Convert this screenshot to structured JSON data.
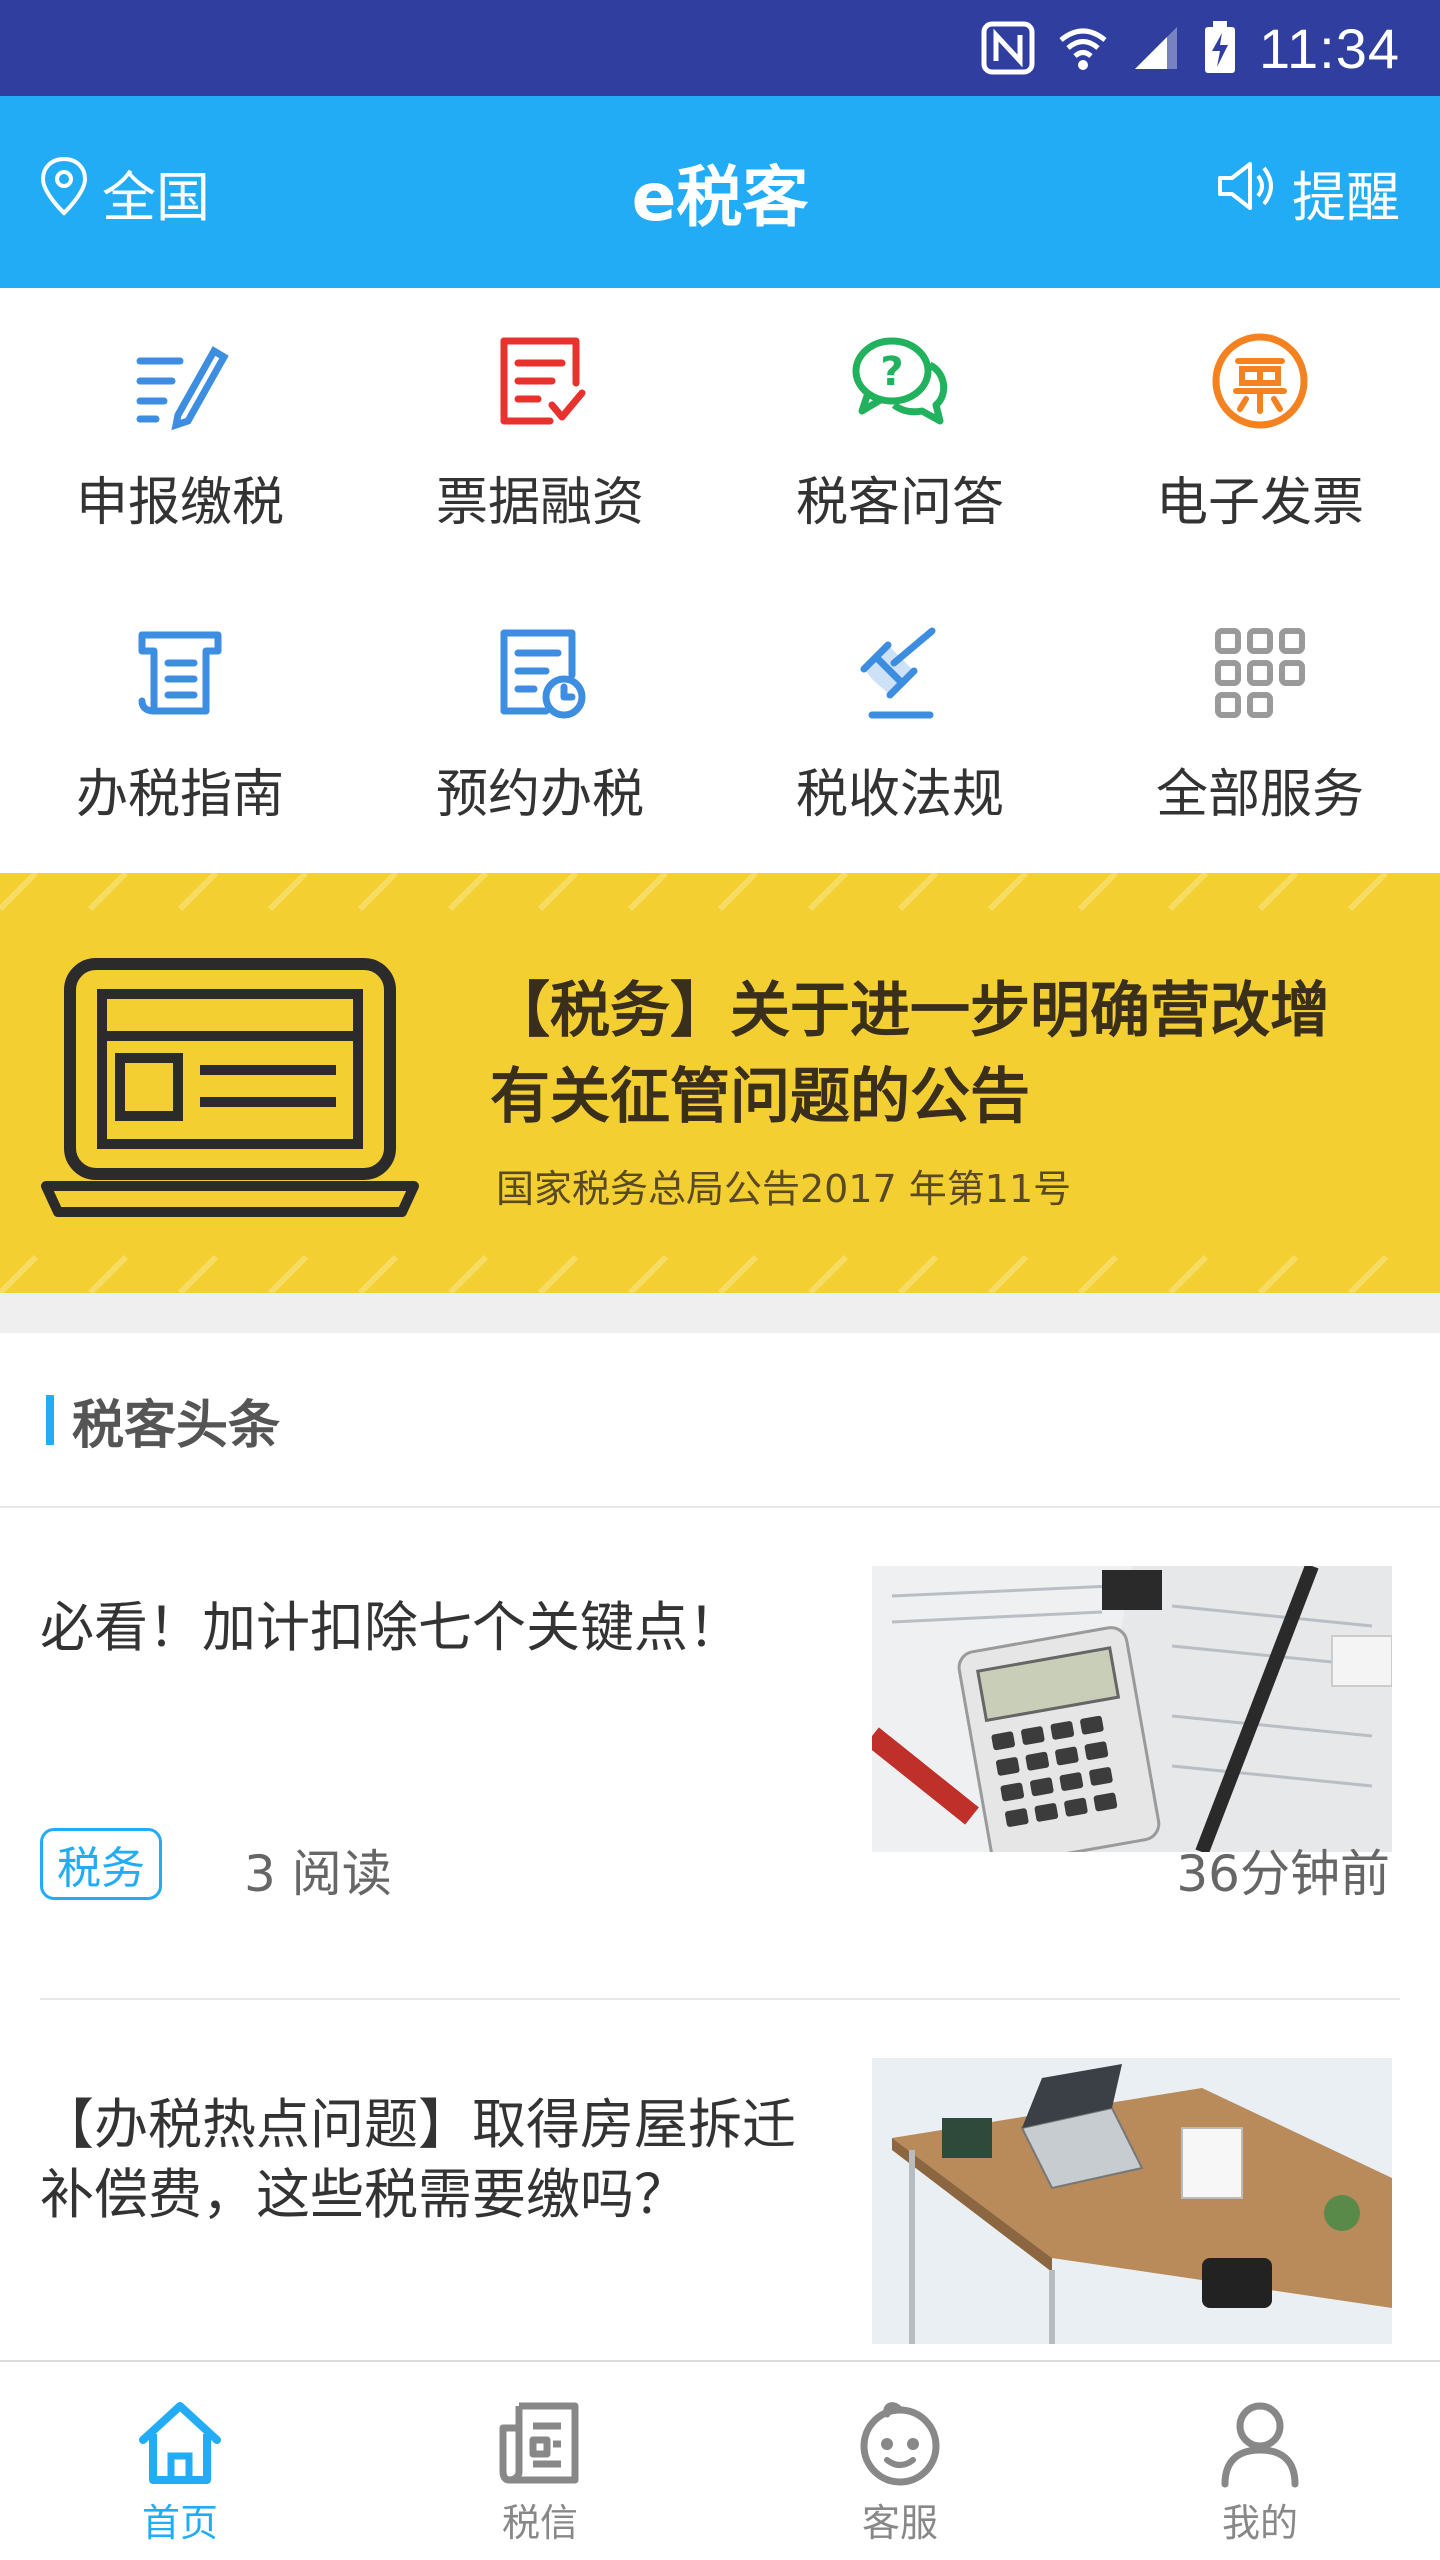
{
  "status_bar": {
    "time": "11:34",
    "icons": [
      "nfc-icon",
      "wifi-icon",
      "signal-icon",
      "battery-charging-icon"
    ]
  },
  "app_bar": {
    "location": "全国",
    "title": "e税客",
    "remind": "提醒",
    "icons": [
      "location-pin-icon",
      "speaker-icon"
    ]
  },
  "services": [
    {
      "label": "申报缴税",
      "icon": "declare-pen-icon",
      "color": "#3d8de0"
    },
    {
      "label": "票据融资",
      "icon": "invoice-finance-icon",
      "color": "#e8322e"
    },
    {
      "label": "税客问答",
      "icon": "chat-question-icon",
      "color": "#22b15d"
    },
    {
      "label": "电子发票",
      "icon": "ticket-coin-icon",
      "color": "#f58220"
    },
    {
      "label": "办税指南",
      "icon": "guide-scroll-icon",
      "color": "#3d8de0"
    },
    {
      "label": "预约办税",
      "icon": "appointment-clock-icon",
      "color": "#3d8de0"
    },
    {
      "label": "税收法规",
      "icon": "gavel-icon",
      "color": "#3d8de0"
    },
    {
      "label": "全部服务",
      "icon": "grid-icon",
      "color": "#9a9a9a"
    }
  ],
  "banner": {
    "title_line1": "【税务】关于进一步明确营改增",
    "title_line2": "有关征管问题的公告",
    "subtitle": "国家税务总局公告2017 年第11号",
    "bg_color": "#f4cf31"
  },
  "news_section": {
    "title": "税客头条",
    "items": [
      {
        "title": "必看！加计扣除七个关键点！",
        "tag": "税务",
        "reads": "3 阅读",
        "time": "36分钟前",
        "image": "calculator-tax-forms-photo"
      },
      {
        "title": "【办税热点问题】取得房屋拆迁补偿费，这些税需要缴吗？",
        "image": "office-desk-photo"
      }
    ]
  },
  "bottom_nav": {
    "tabs": [
      {
        "label": "首页",
        "icon": "home-icon",
        "active": true
      },
      {
        "label": "税信",
        "icon": "news-doc-icon",
        "active": false
      },
      {
        "label": "客服",
        "icon": "service-face-icon",
        "active": false
      },
      {
        "label": "我的",
        "icon": "person-icon",
        "active": false
      }
    ],
    "active_color": "#22acf5",
    "inactive_color": "#888888"
  }
}
